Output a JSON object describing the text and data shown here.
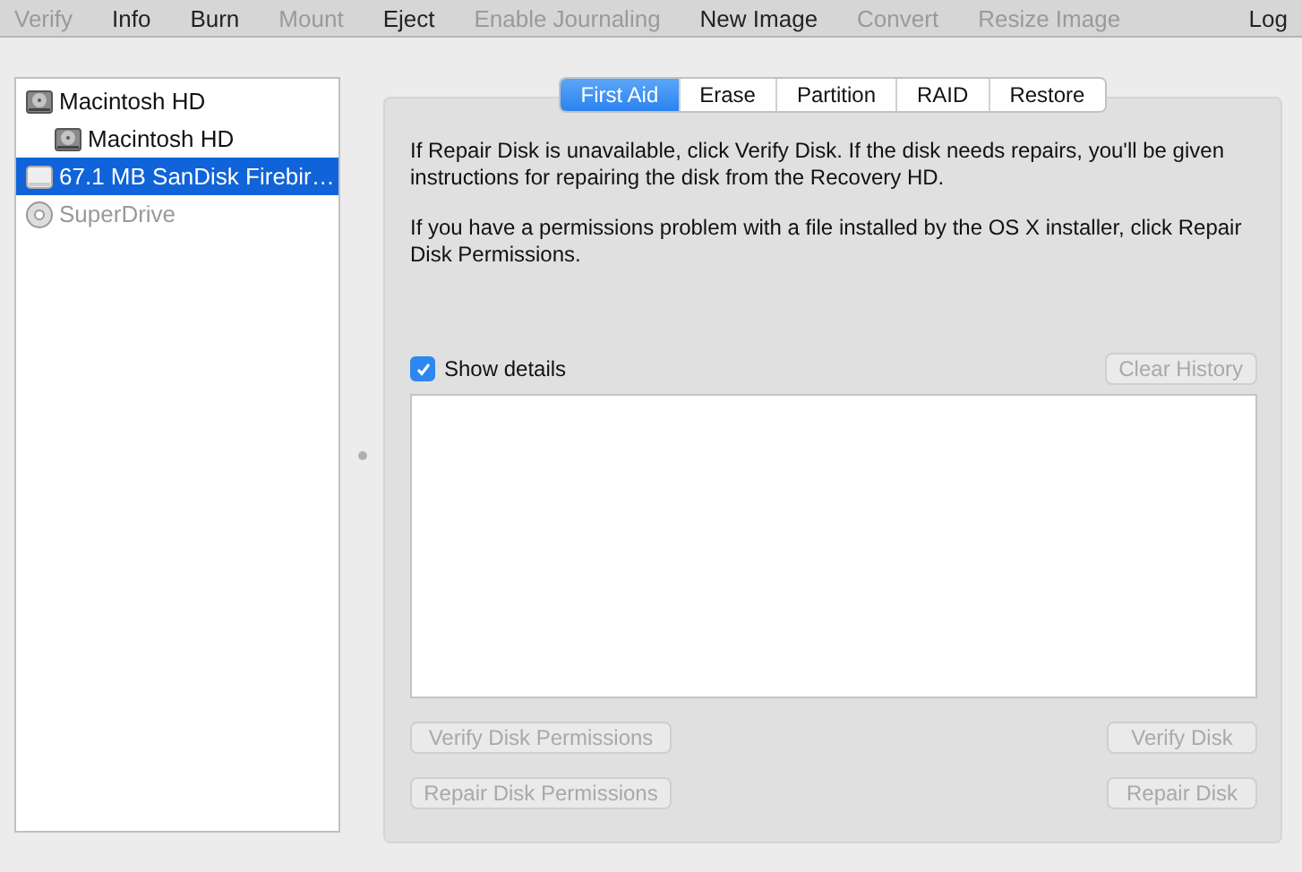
{
  "toolbar": {
    "items": [
      {
        "label": "Verify",
        "disabled": true
      },
      {
        "label": "Info",
        "disabled": false
      },
      {
        "label": "Burn",
        "disabled": false
      },
      {
        "label": "Mount",
        "disabled": true
      },
      {
        "label": "Eject",
        "disabled": false
      },
      {
        "label": "Enable Journaling",
        "disabled": true
      },
      {
        "label": "New Image",
        "disabled": false
      },
      {
        "label": "Convert",
        "disabled": true
      },
      {
        "label": "Resize Image",
        "disabled": true
      }
    ],
    "right": {
      "label": "Log",
      "disabled": false
    }
  },
  "sidebar": {
    "items": [
      {
        "label": "Macintosh HD",
        "kind": "hard-disk",
        "selected": false,
        "disabled": false,
        "children": [
          {
            "label": "Macintosh HD",
            "kind": "hard-disk",
            "selected": false,
            "disabled": false
          }
        ]
      },
      {
        "label": "67.1 MB SanDisk Firebir…",
        "kind": "external-disk",
        "selected": true,
        "disabled": false
      },
      {
        "label": "SuperDrive",
        "kind": "optical-drive",
        "selected": false,
        "disabled": true
      }
    ]
  },
  "tabs": [
    {
      "label": "First Aid",
      "selected": true
    },
    {
      "label": "Erase",
      "selected": false
    },
    {
      "label": "Partition",
      "selected": false
    },
    {
      "label": "RAID",
      "selected": false
    },
    {
      "label": "Restore",
      "selected": false
    }
  ],
  "paragraphs": [
    "If Repair Disk is unavailable, click Verify Disk. If the disk needs repairs, you'll be given instructions for repairing the disk from the Recovery HD.",
    "If you have a permissions problem with a file installed by the OS X installer, click Repair Disk Permissions."
  ],
  "show_details": {
    "label": "Show details",
    "checked": true
  },
  "clear_history": {
    "label": "Clear History",
    "disabled": true
  },
  "buttons": [
    {
      "label": "Verify Disk Permissions",
      "disabled": true
    },
    {
      "label": "Verify Disk",
      "disabled": true
    },
    {
      "label": "Repair Disk Permissions",
      "disabled": true
    },
    {
      "label": "Repair Disk",
      "disabled": true
    }
  ]
}
